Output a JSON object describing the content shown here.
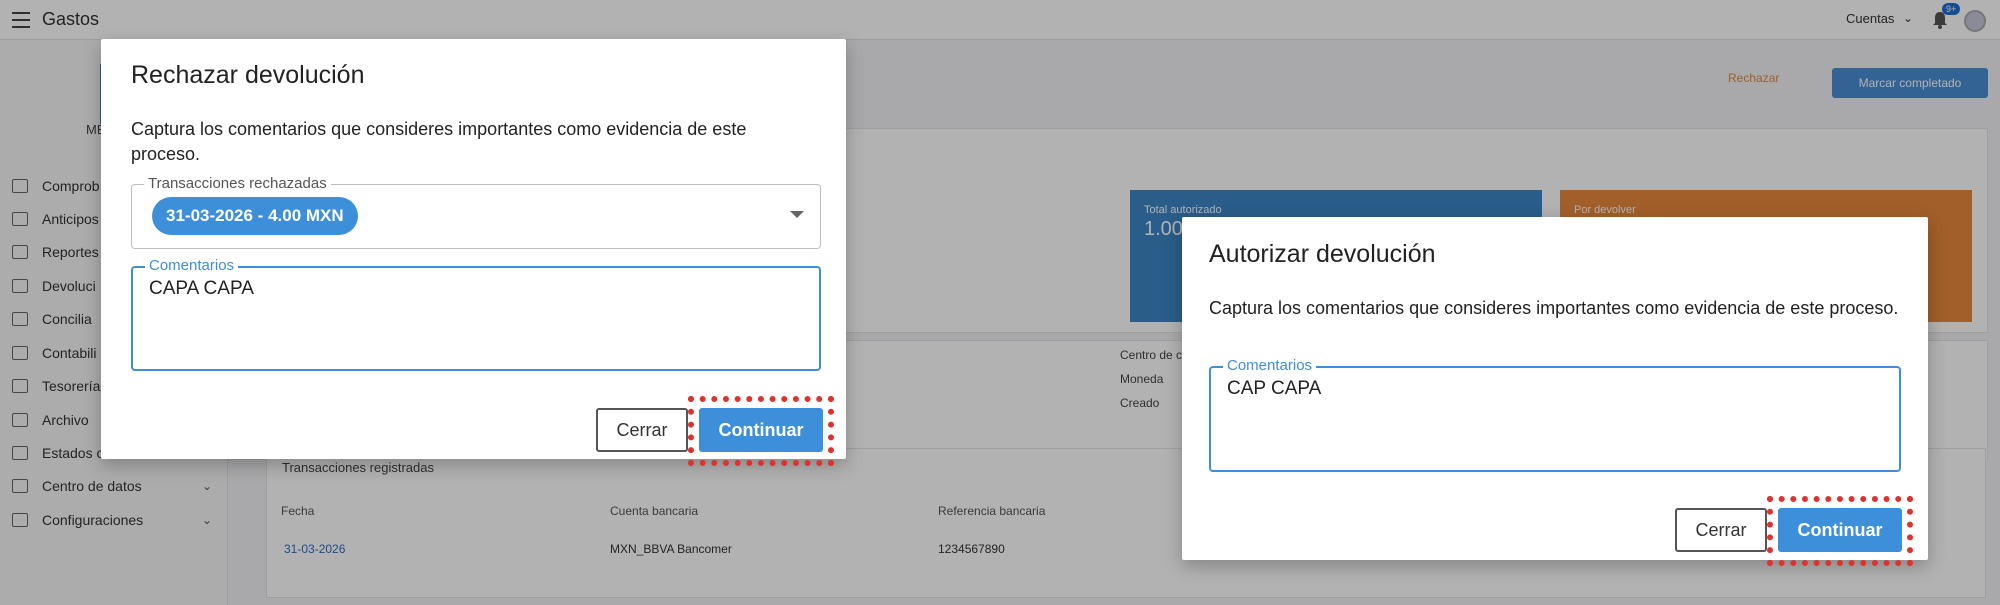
{
  "topbar": {
    "title": "Gastos",
    "account_label": "Cuentas",
    "badge": "9+"
  },
  "sidebar": {
    "user": "MB",
    "items": [
      {
        "label": "Comprob"
      },
      {
        "label": "Anticipos"
      },
      {
        "label": "Reportes"
      },
      {
        "label": "Devoluci"
      },
      {
        "label": "Concilia"
      },
      {
        "label": "Contabili"
      },
      {
        "label": "Tesorería"
      },
      {
        "label": "Archivo"
      },
      {
        "label": "Estados c"
      },
      {
        "label": "Centro de datos"
      },
      {
        "label": "Configuraciones"
      }
    ]
  },
  "header_actions": {
    "reject": "Rechazar",
    "complete": "Marcar completado"
  },
  "cards": {
    "authorized": {
      "label": "Total autorizado",
      "value": "1.00"
    },
    "to_return": {
      "label": "Por devolver"
    }
  },
  "details": {
    "cost_center": "Centro de c",
    "currency": "Moneda",
    "created": "Creado"
  },
  "transactions": {
    "title": "Transacciones registradas",
    "columns": [
      "Fecha",
      "Cuenta bancaria",
      "Referencia bancaria"
    ],
    "rows": [
      {
        "date": "31-03-2026",
        "account": "MXN_BBVA Bancomer",
        "reference": "1234567890"
      }
    ]
  },
  "reject_modal": {
    "title": "Rechazar devolución",
    "description": "Captura los comentarios que consideres importantes como evidencia de este proceso.",
    "transactions_label": "Transacciones rechazadas",
    "chip": "31-03-2026 - 4.00 MXN",
    "comments_label": "Comentarios",
    "comments_value": "CAPA CAPA",
    "close": "Cerrar",
    "continue": "Continuar"
  },
  "authorize_modal": {
    "title": "Autorizar devolución",
    "description": "Captura los comentarios que consideres importantes como evidencia de este proceso.",
    "comments_label": "Comentarios",
    "comments_value": "CAP CAPA",
    "close": "Cerrar",
    "continue": "Continuar"
  },
  "colors": {
    "accent": "#3d8fd9",
    "highlight": "#e0322d",
    "warning": "#e8883c"
  }
}
